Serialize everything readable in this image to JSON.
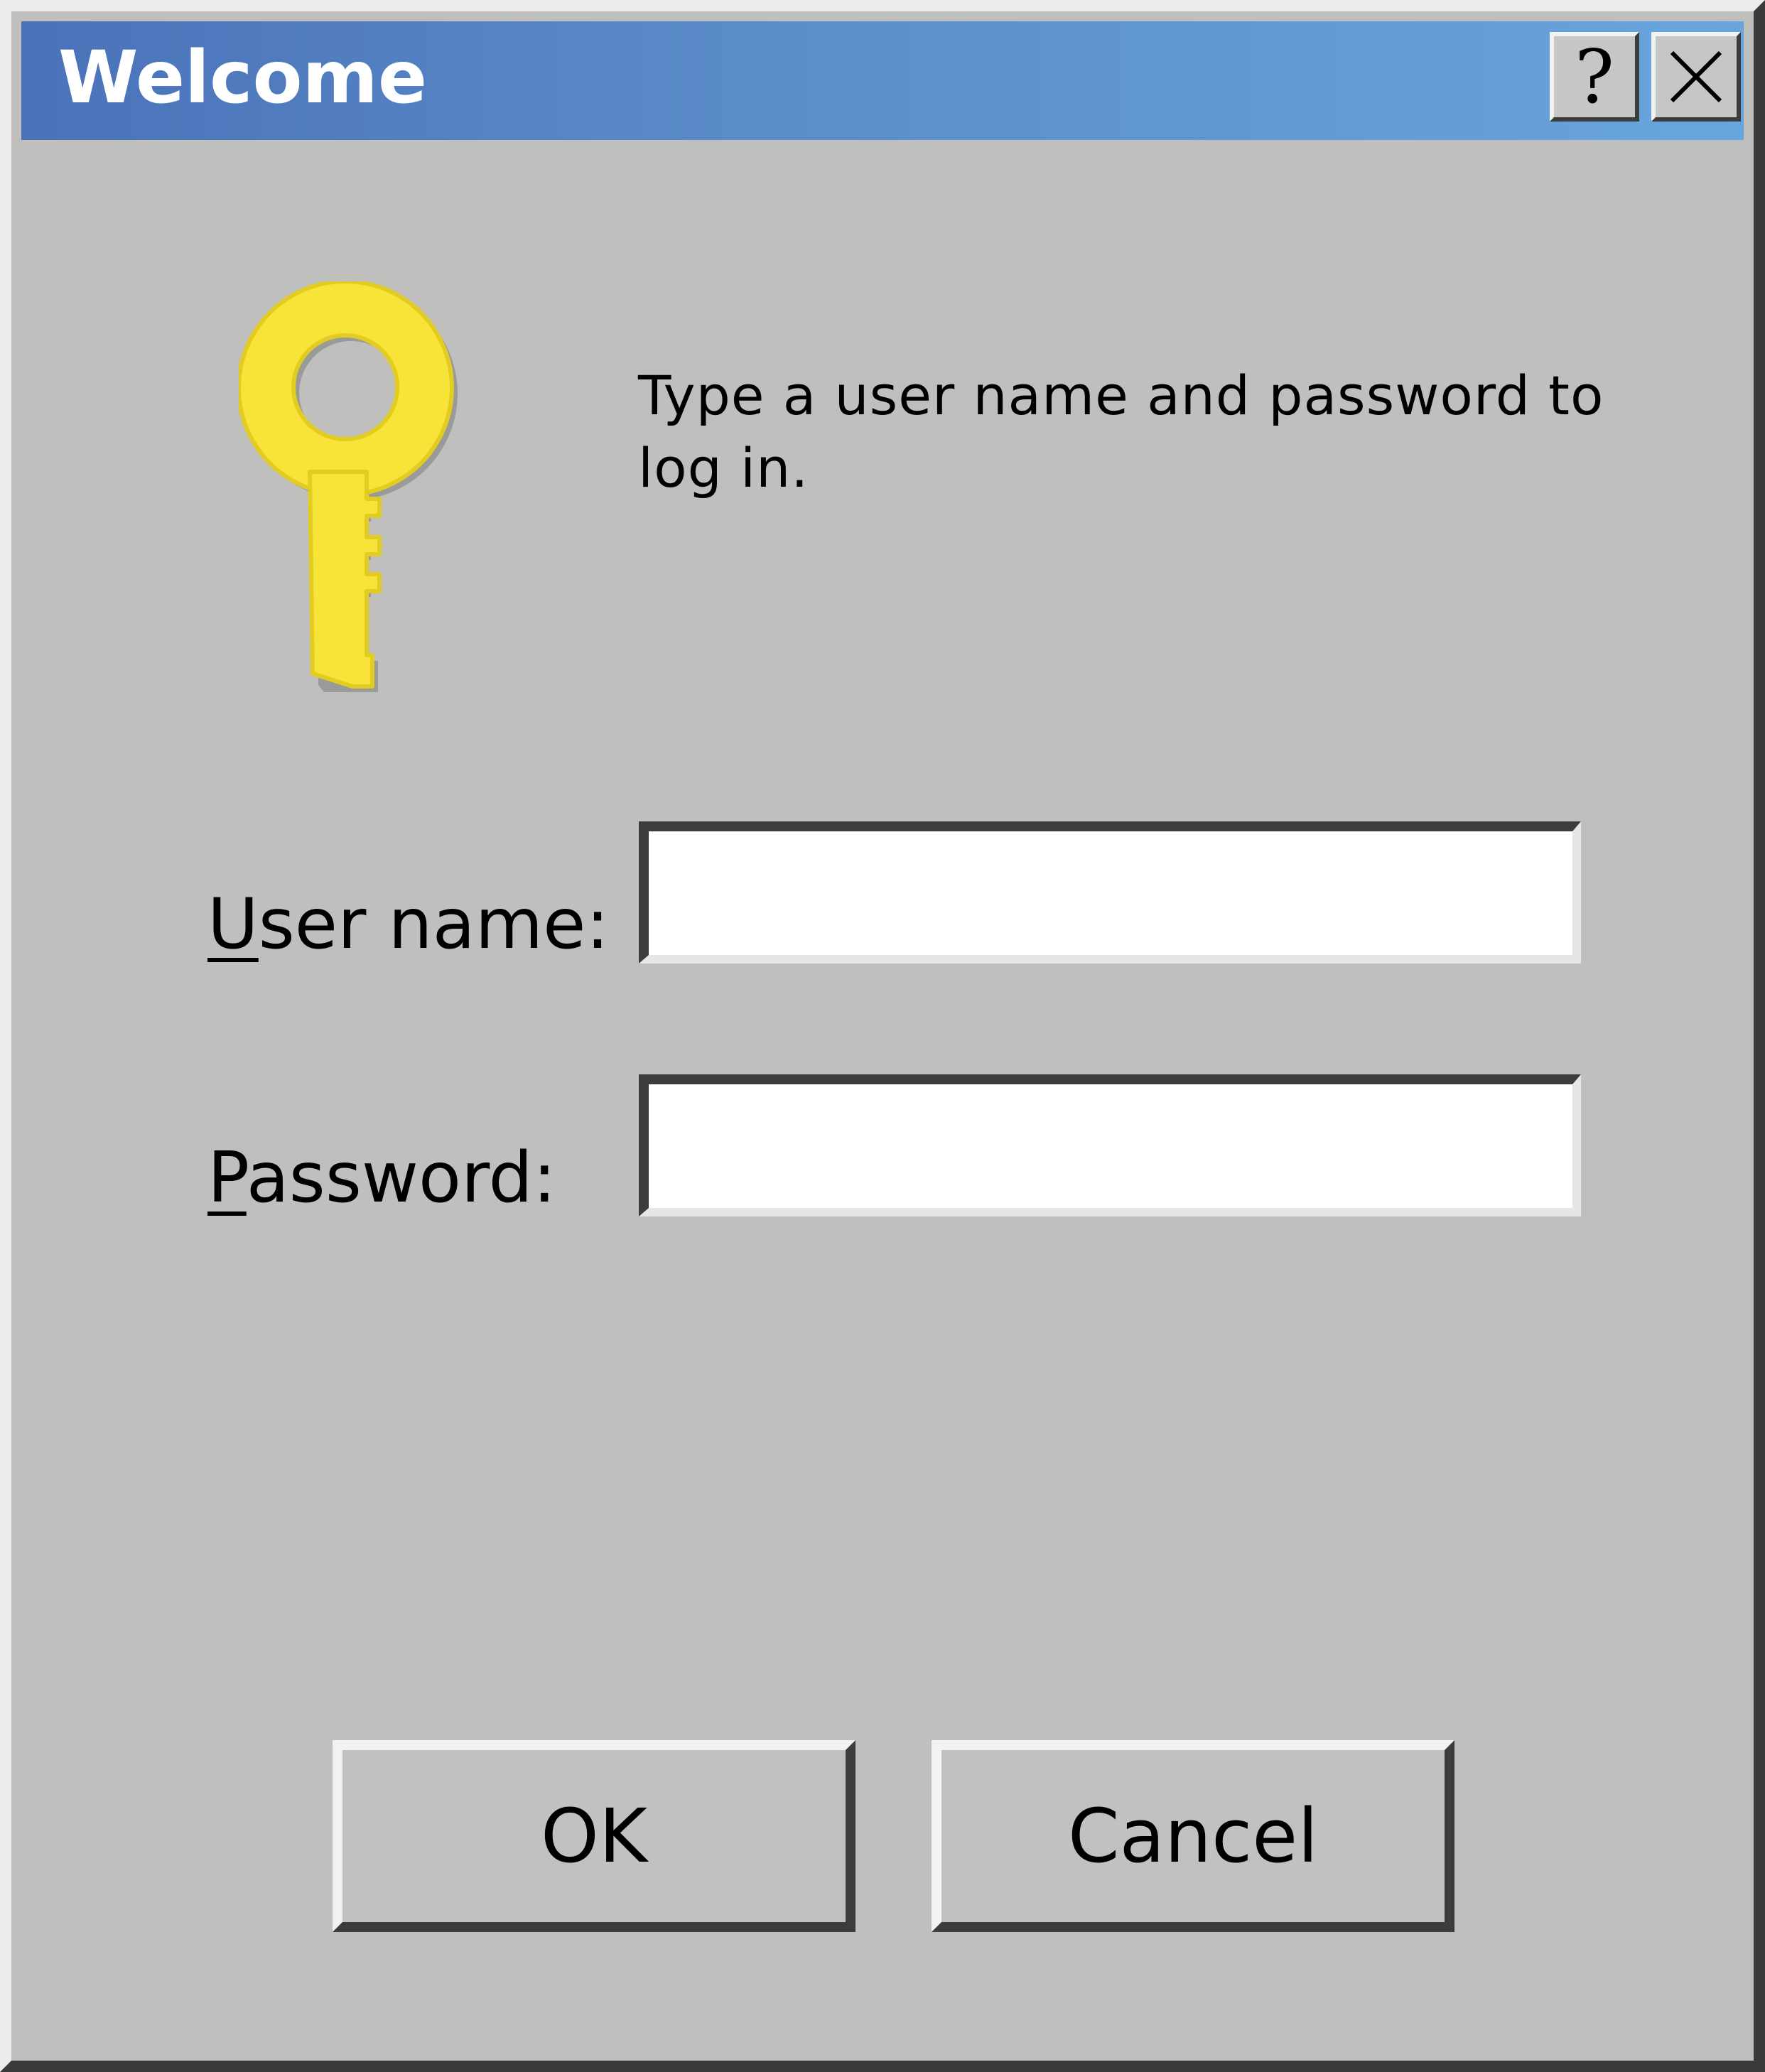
{
  "window": {
    "title": "Welcome",
    "help_button": "?",
    "close_icon": "close-icon"
  },
  "icon": {
    "name": "key-icon",
    "color": "#f8e438"
  },
  "prompt": {
    "text": "Type a user name and password to log in."
  },
  "form": {
    "username": {
      "label_accel": "U",
      "label_rest": "ser name:",
      "value": ""
    },
    "password": {
      "label_accel": "P",
      "label_rest": "assword:",
      "value": ""
    }
  },
  "buttons": {
    "ok": "OK",
    "cancel": "Cancel"
  },
  "colors": {
    "titlebar_start": "#4a72b9",
    "titlebar_end": "#68a5dd",
    "dialog_background": "#bfbfbd"
  }
}
